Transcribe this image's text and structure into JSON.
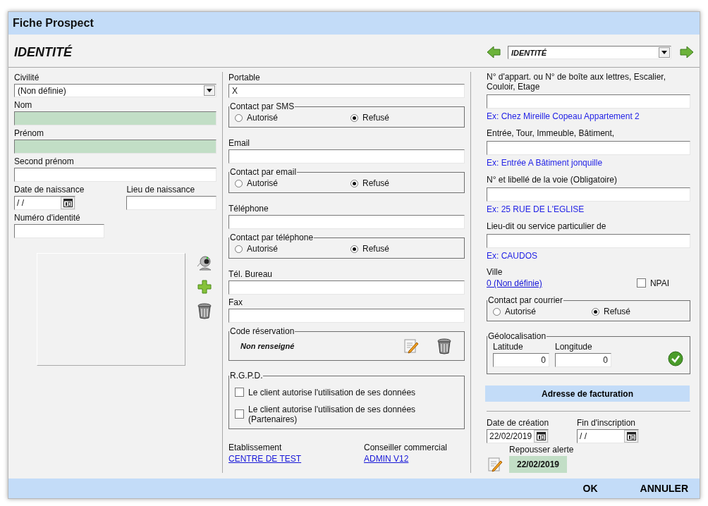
{
  "window": {
    "title": "Fiche Prospect"
  },
  "header": {
    "title": "IDENTITÉ",
    "section": "IDENTITÉ"
  },
  "identity": {
    "civility": {
      "label": "Civilité",
      "value": "(Non définie)"
    },
    "fields": [
      {
        "label": "Nom",
        "required": true
      },
      {
        "label": "Prénom",
        "required": true
      },
      {
        "label": "Second prénom",
        "required": false
      }
    ],
    "birth_date": {
      "label": "Date de naissance",
      "value": "/ /"
    },
    "birth_place": {
      "label": "Lieu de naissance"
    },
    "id_number": {
      "label": "Numéro d'identité"
    }
  },
  "contact": [
    {
      "kind": "field",
      "label": "Portable",
      "value": "X"
    },
    {
      "kind": "choice",
      "legend": "Contact par SMS",
      "options": [
        {
          "label": "Autorisé",
          "selected": false
        },
        {
          "label": "Refusé",
          "selected": true
        }
      ]
    },
    {
      "kind": "field",
      "label": "Email"
    },
    {
      "kind": "choice",
      "legend": "Contact par email",
      "options": [
        {
          "label": "Autorisé",
          "selected": false
        },
        {
          "label": "Refusé",
          "selected": true
        }
      ]
    },
    {
      "kind": "field",
      "label": "Téléphone"
    },
    {
      "kind": "choice",
      "legend": "Contact par téléphone",
      "options": [
        {
          "label": "Autorisé",
          "selected": false
        },
        {
          "label": "Refusé",
          "selected": true
        }
      ]
    },
    {
      "kind": "field",
      "label": "Tél. Bureau"
    },
    {
      "kind": "field",
      "label": "Fax"
    }
  ],
  "reservation": {
    "legend": "Code réservation",
    "value": "Non renseigné"
  },
  "rgpd": {
    "legend": "R.G.P.D.",
    "options": [
      {
        "label": "Le client autorise l'utilisation de ses données",
        "checked": false
      },
      {
        "label": "Le client autorise l'utilisation de ses données (Partenaires)",
        "checked": false
      }
    ]
  },
  "links": [
    {
      "label": "Etablissement",
      "value": "CENTRE DE TEST"
    },
    {
      "label": "Conseiller commercial",
      "value": "ADMIN V12"
    }
  ],
  "address": {
    "lines": [
      {
        "label": "N° d'appart. ou N° de boîte aux lettres, Escalier, Couloir, Etage",
        "example": "Ex: Chez Mireille Copeau Appartement 2"
      },
      {
        "label": "Entrée, Tour, Immeuble, Bâtiment,",
        "example": "Ex: Entrée A Bâtiment jonquille"
      },
      {
        "label": "N° et libellé de la voie (Obligatoire)",
        "example": "Ex: 25 RUE DE L'EGLISE"
      },
      {
        "label": "Lieu-dit ou service particulier de",
        "example": "Ex: CAUDOS"
      }
    ],
    "city": {
      "label": "Ville",
      "value": "0 (Non définie)"
    },
    "npai": {
      "label": "NPAI",
      "checked": false
    },
    "mail_contact": {
      "legend": "Contact par courrier",
      "options": [
        {
          "label": "Autorisé",
          "selected": false
        },
        {
          "label": "Refusé",
          "selected": true
        }
      ]
    },
    "geolocation": {
      "legend": "Géolocalisation",
      "latitude": {
        "label": "Latitude",
        "value": "0"
      },
      "longitude": {
        "label": "Longitude",
        "value": "0"
      }
    },
    "billing_button": "Adresse de facturation"
  },
  "dates": {
    "created": {
      "label": "Date de création",
      "value": "22/02/2019"
    },
    "end": {
      "label": "Fin d'inscription",
      "value": "/ /"
    },
    "alert": {
      "label": "Repousser alerte",
      "value": "22/02/2019"
    }
  },
  "buttons": [
    "OK",
    "ANNULER"
  ]
}
